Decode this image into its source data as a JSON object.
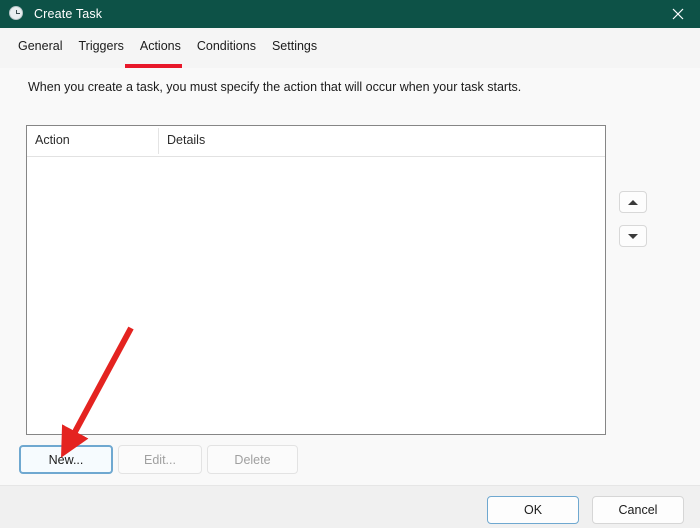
{
  "window": {
    "title": "Create Task",
    "icon": "clock-icon",
    "close_label": "✕",
    "titlebar_color": "#0d5247"
  },
  "tabs": [
    {
      "label": "General",
      "selected": false
    },
    {
      "label": "Triggers",
      "selected": false
    },
    {
      "label": "Actions",
      "selected": true
    },
    {
      "label": "Conditions",
      "selected": false
    },
    {
      "label": "Settings",
      "selected": false
    }
  ],
  "highlight": {
    "underline_color": "#e8182a",
    "arrow_color": "#e42320"
  },
  "main": {
    "description": "When you create a task, you must specify the action that will occur when your task starts.",
    "list": {
      "columns": [
        "Action",
        "Details"
      ],
      "rows": []
    },
    "reorder": {
      "move_up_label": "▲",
      "move_down_label": "▼"
    },
    "buttons": [
      {
        "label": "New...",
        "enabled": true,
        "focused": true
      },
      {
        "label": "Edit...",
        "enabled": false,
        "focused": false
      },
      {
        "label": "Delete",
        "enabled": false,
        "focused": false
      }
    ]
  },
  "footer": {
    "ok_label": "OK",
    "cancel_label": "Cancel"
  }
}
